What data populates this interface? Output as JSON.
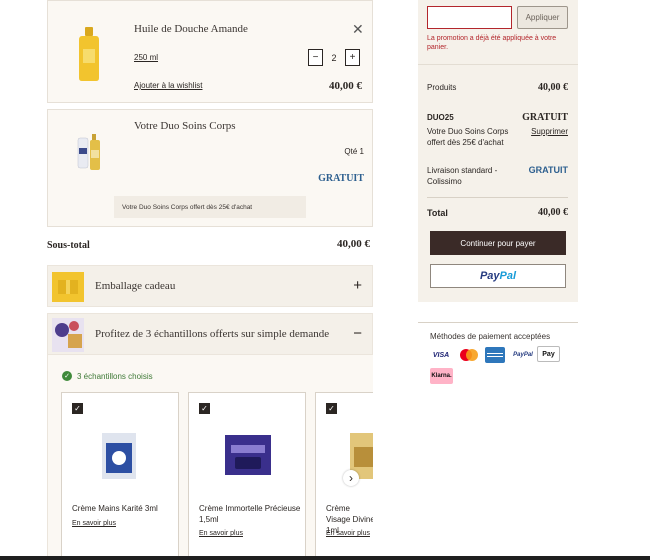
{
  "cart": {
    "item1": {
      "name": "Huile de Douche Amande",
      "size": "250 ml",
      "qty": "2",
      "minus": "−",
      "plus": "+",
      "wishlist": "Ajouter à la wishlist",
      "price": "40,00 €",
      "close": "✕"
    },
    "item2": {
      "name": "Votre Duo Soins Corps",
      "qty_label": "Qté 1",
      "price": "GRATUIT",
      "note": "Votre Duo Soins Corps offert dès 25€ d'achat"
    },
    "subtotal_label": "Sous-total",
    "subtotal_value": "40,00 €",
    "gift_wrap": {
      "label": "Emballage cadeau",
      "toggle": "+"
    },
    "samples": {
      "label": "Profitez de 3 échantillons offerts sur simple demande",
      "toggle": "−",
      "chosen": "3 échantillons choisis",
      "items": [
        {
          "name": "Crème Mains Karité 3ml",
          "link": "En savoir plus"
        },
        {
          "name": "Crème Immortelle Précieuse 1,5ml",
          "link": "En savoir plus"
        },
        {
          "name": "Crème Visage Divine 1ml",
          "link": "En savoir plus"
        }
      ],
      "next": "›"
    }
  },
  "summary": {
    "promo_placeholder": "",
    "apply_label": "Appliquer",
    "promo_error": "La promotion a déjà été appliquée à votre panier.",
    "produits_label": "Produits",
    "produits_value": "40,00 €",
    "promo_code": "DUO25",
    "promo_value": "GRATUIT",
    "promo_desc": "Votre Duo Soins Corps offert dès 25€ d'achat",
    "promo_remove": "Supprimer",
    "shipping_label": "Livraison standard - Colissimo",
    "shipping_value": "GRATUIT",
    "total_label": "Total",
    "total_value": "40,00 €",
    "continue_label": "Continuer pour payer",
    "paypal_pay": "Pay",
    "paypal_pal": "Pal"
  },
  "payment": {
    "title": "Méthodes de paiement acceptées",
    "methods": [
      "VISA",
      "Mastercard",
      "AMEX",
      "PayPal",
      "Apple Pay",
      "Klarna."
    ],
    "visa": "VISA",
    "paypal_small": "PayPal",
    "applepay": " Pay",
    "klarna": "Klarna."
  },
  "colors": {
    "primary_dark": "#3a2a27",
    "free_blue": "#2d5f8f",
    "error_red": "#b3262c",
    "panel_bg": "#f5f1ea"
  }
}
